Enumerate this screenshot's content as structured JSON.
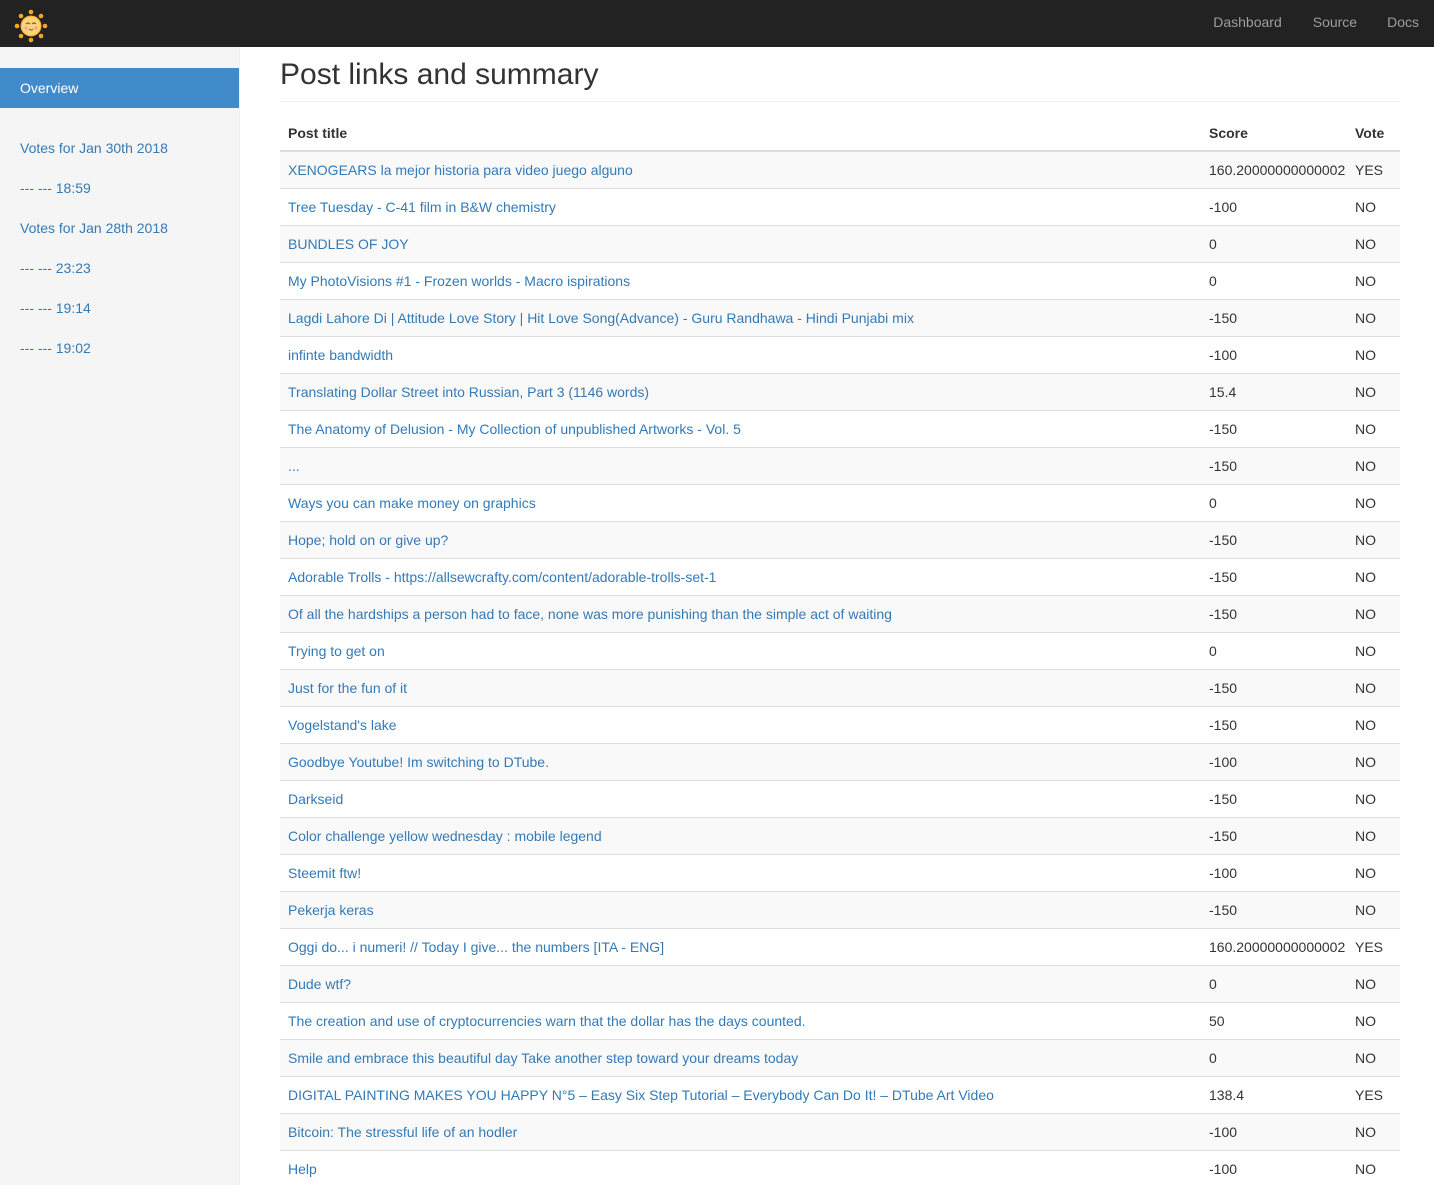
{
  "nav": {
    "links": [
      "Dashboard",
      "Source",
      "Docs"
    ]
  },
  "sidebar": {
    "active": "Overview",
    "items": [
      "Votes for Jan 30th 2018",
      "--- --- 18:59",
      "Votes for Jan 28th 2018",
      "--- --- 23:23",
      "--- --- 19:14",
      "--- --- 19:02"
    ]
  },
  "page": {
    "title": "Post links and summary"
  },
  "table": {
    "headers": [
      "Post title",
      "Score",
      "Vote"
    ],
    "rows": [
      {
        "title": "XENOGEARS la mejor historia para video juego alguno",
        "score": "160.20000000000002",
        "vote": "YES"
      },
      {
        "title": "Tree Tuesday - C-41 film in B&W chemistry",
        "score": "-100",
        "vote": "NO"
      },
      {
        "title": "BUNDLES OF JOY",
        "score": "0",
        "vote": "NO"
      },
      {
        "title": "My PhotoVisions #1 - Frozen worlds - Macro ispirations",
        "score": "0",
        "vote": "NO"
      },
      {
        "title": "Lagdi Lahore Di | Attitude Love Story | Hit Love Song(Advance) - Guru Randhawa - Hindi Punjabi mix",
        "score": "-150",
        "vote": "NO"
      },
      {
        "title": "infinte bandwidth",
        "score": "-100",
        "vote": "NO"
      },
      {
        "title": "Translating Dollar Street into Russian, Part 3 (1146 words)",
        "score": "15.4",
        "vote": "NO"
      },
      {
        "title": "The Anatomy of Delusion - My Collection of unpublished Artworks - Vol. 5",
        "score": "-150",
        "vote": "NO"
      },
      {
        "title": "...",
        "score": "-150",
        "vote": "NO"
      },
      {
        "title": "Ways you can make money on graphics",
        "score": "0",
        "vote": "NO"
      },
      {
        "title": "Hope; hold on or give up?",
        "score": "-150",
        "vote": "NO"
      },
      {
        "title": "Adorable Trolls - https://allsewcrafty.com/content/adorable-trolls-set-1",
        "score": "-150",
        "vote": "NO"
      },
      {
        "title": "Of all the hardships a person had to face, none was more punishing than the simple act of waiting",
        "score": "-150",
        "vote": "NO"
      },
      {
        "title": "Trying to get on",
        "score": "0",
        "vote": "NO"
      },
      {
        "title": "Just for the fun of it",
        "score": "-150",
        "vote": "NO"
      },
      {
        "title": "Vogelstand's lake",
        "score": "-150",
        "vote": "NO"
      },
      {
        "title": "Goodbye Youtube! Im switching to DTube.",
        "score": "-100",
        "vote": "NO"
      },
      {
        "title": "Darkseid",
        "score": "-150",
        "vote": "NO"
      },
      {
        "title": "Color challenge yellow wednesday : mobile legend",
        "score": "-150",
        "vote": "NO"
      },
      {
        "title": "Steemit ftw!",
        "score": "-100",
        "vote": "NO"
      },
      {
        "title": "Pekerja keras",
        "score": "-150",
        "vote": "NO"
      },
      {
        "title": "Oggi do... i numeri! // Today I give... the numbers [ITA - ENG]",
        "score": "160.20000000000002",
        "vote": "YES"
      },
      {
        "title": "Dude wtf?",
        "score": "0",
        "vote": "NO"
      },
      {
        "title": "The creation and use of cryptocurrencies warn that the dollar has the days counted.",
        "score": "50",
        "vote": "NO"
      },
      {
        "title": "Smile and embrace this beautiful day Take another step toward your dreams today",
        "score": "0",
        "vote": "NO"
      },
      {
        "title": "DIGITAL PAINTING MAKES YOU HAPPY N°5 – Easy Six Step Tutorial – Everybody Can Do It! – DTube Art Video",
        "score": "138.4",
        "vote": "YES"
      },
      {
        "title": "Bitcoin: The stressful life of an hodler",
        "score": "-100",
        "vote": "NO"
      },
      {
        "title": "Help",
        "score": "-100",
        "vote": "NO"
      }
    ]
  }
}
